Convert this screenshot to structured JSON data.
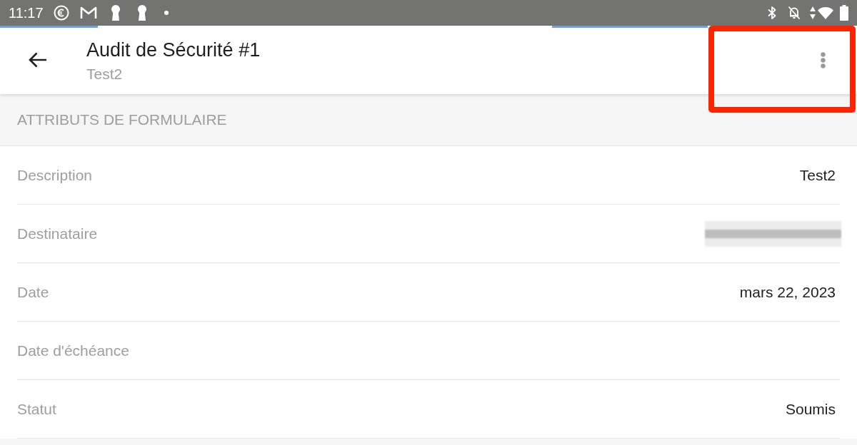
{
  "status_bar": {
    "time": "11:17"
  },
  "loading": true,
  "app_bar": {
    "title": "Audit de Sécurité #1",
    "subtitle": "Test2",
    "menu_highlighted": true
  },
  "section": {
    "title": "ATTRIBUTS DE FORMULAIRE",
    "fields": [
      {
        "label": "Description",
        "value": "Test2",
        "redacted": false
      },
      {
        "label": "Destinataire",
        "redacted": true
      },
      {
        "label": "Date",
        "value": "mars 22, 2023",
        "redacted": false
      },
      {
        "label": "Date d'échéance",
        "redacted": false
      },
      {
        "label": "Statut",
        "value": "Soumis",
        "redacted": false
      }
    ]
  }
}
